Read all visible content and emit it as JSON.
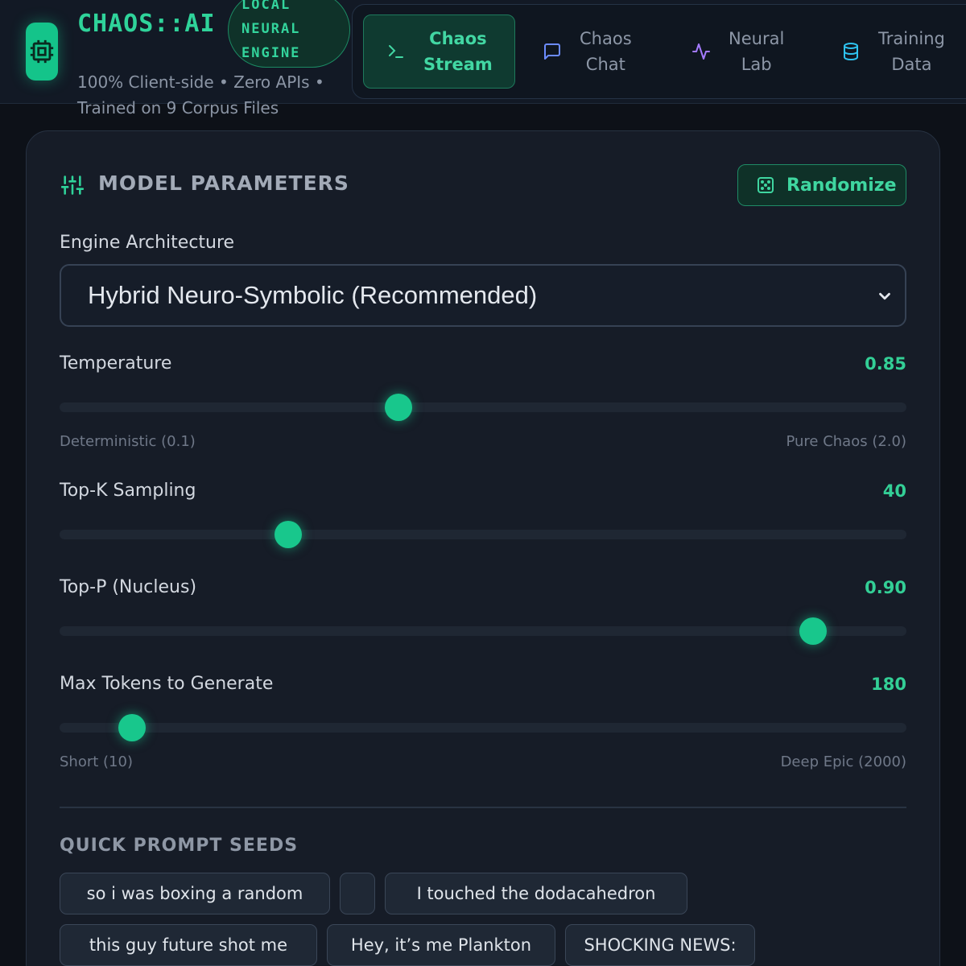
{
  "header": {
    "brand": "CHAOS::AI",
    "badge_lines": [
      "LOCAL",
      "NEURAL",
      "ENGINE"
    ],
    "subtitle_line1": "100% Client-side • Zero APIs •",
    "subtitle_line2": "Trained on 9 Corpus Files",
    "logo_icon": "cpu-icon"
  },
  "nav": {
    "items": [
      {
        "line1": "Chaos",
        "line2": "Stream",
        "icon": "terminal-icon",
        "active": true
      },
      {
        "line1": "Chaos",
        "line2": "Chat",
        "icon": "chat-bubble-icon",
        "active": false
      },
      {
        "line1": "Neural",
        "line2": "Lab",
        "icon": "activity-icon",
        "active": false
      },
      {
        "line1": "Training",
        "line2": "Data",
        "icon": "database-icon",
        "active": false
      }
    ]
  },
  "panel": {
    "title": "MODEL PARAMETERS",
    "title_icon": "sliders-icon",
    "randomize_label": "Randomize",
    "randomize_icon": "dice-icon"
  },
  "engine": {
    "label": "Engine Architecture",
    "selected": "Hybrid Neuro-Symbolic (Recommended)"
  },
  "params": {
    "temperature": {
      "label": "Temperature",
      "value": "0.85",
      "fraction": 0.4,
      "min_hint": "Deterministic (0.1)",
      "max_hint": "Pure Chaos (2.0)"
    },
    "top_k": {
      "label": "Top-K Sampling",
      "value": "40",
      "fraction": 0.27
    },
    "top_p": {
      "label": "Top-P (Nucleus)",
      "value": "0.90",
      "fraction": 0.89
    },
    "max_tokens": {
      "label": "Max Tokens to Generate",
      "value": "180",
      "fraction": 0.086,
      "min_hint": "Short (10)",
      "max_hint": "Deep Epic (2000)"
    }
  },
  "seeds": {
    "title": "QUICK PROMPT SEEDS",
    "items": [
      "so i was boxing a random",
      "",
      "I touched the dodacahedron",
      "this guy future shot me",
      "Hey, it’s me Plankton",
      "SHOCKING NEWS:"
    ]
  },
  "colors": {
    "accent": "#18c78c",
    "background": "#0d1118",
    "panel": "#161c27"
  }
}
